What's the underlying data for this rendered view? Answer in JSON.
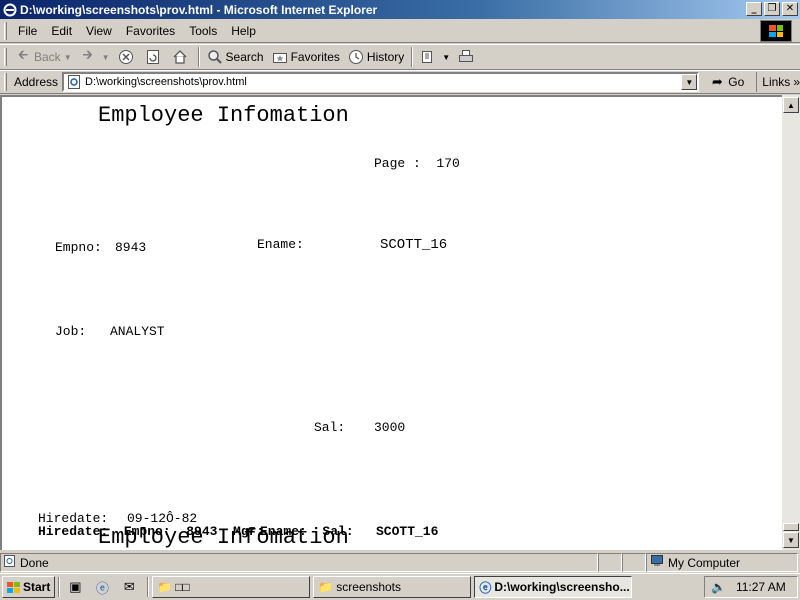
{
  "window": {
    "title": "D:\\working\\screenshots\\prov.html - Microsoft Internet Explorer",
    "minimize_icon": "minimize-icon",
    "restore_icon": "restore-icon",
    "close_icon": "close-icon"
  },
  "menu": {
    "items": [
      "File",
      "Edit",
      "View",
      "Favorites",
      "Tools",
      "Help"
    ]
  },
  "toolbar": {
    "back_label": "Back",
    "search_label": "Search",
    "favorites_label": "Favorites",
    "history_label": "History"
  },
  "address": {
    "label": "Address",
    "url": "D:\\working\\screenshots\\prov.html",
    "go_label": "Go",
    "links_label": "Links"
  },
  "document": {
    "heading": "Employee Infomation",
    "page_text": "Page :  170",
    "empno_label": "Empno:",
    "empno_value": "8943",
    "ename_label": "Ename:",
    "ename_value": "SCOTT_16",
    "job_label": "Job:",
    "job_value": "ANALYST",
    "sal_label": "Sal:",
    "sal_value": "3000",
    "hiredate_label": "Hiredate:",
    "hiredate_value": "09-12Ô-82",
    "overlap_line_a": "Hiredate:  Empno:  8943  Mgr:",
    "overlap_line_b": "Ename:  Sal:",
    "overlap_value": "SCOTT_16",
    "overlap_heading": "Employee Infomation"
  },
  "status": {
    "text": "Done",
    "zone": "My Computer"
  },
  "taskbar": {
    "start_label": "Start",
    "tasks": [
      "□□",
      "screenshots",
      "D:\\working\\screensho..."
    ],
    "clock": "11:27 AM"
  },
  "colors": {
    "titlebar_start": "#0a246a",
    "titlebar_end": "#a6caf0",
    "chrome": "#d4d0c8"
  }
}
